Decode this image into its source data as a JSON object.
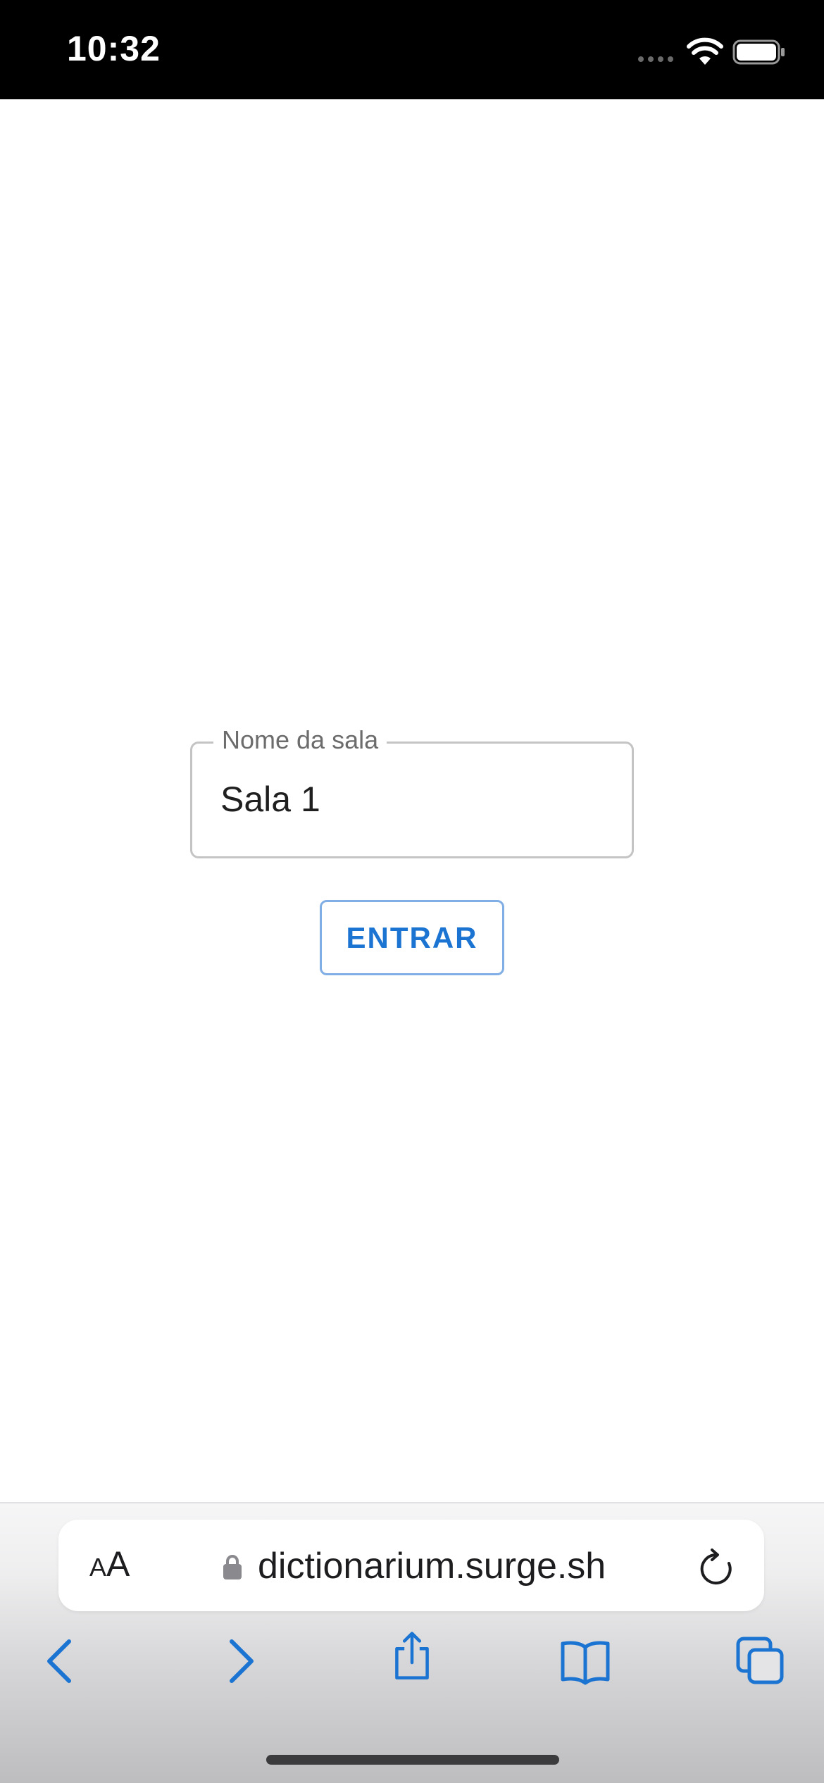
{
  "status_bar": {
    "time": "10:32",
    "wifi_icon": "wifi-icon",
    "battery_icon": "battery-icon"
  },
  "form": {
    "room_label": "Nome da sala",
    "room_value": "Sala 1",
    "enter_label": "ENTRAR"
  },
  "browser": {
    "text_size_small": "A",
    "text_size_large": "A",
    "url": "dictionarium.surge.sh",
    "icons": {
      "lock": "lock-icon",
      "reload": "reload-icon",
      "back": "back-icon",
      "forward": "forward-icon",
      "share": "share-icon",
      "bookmarks": "bookmarks-icon",
      "tabs": "tabs-icon"
    }
  },
  "colors": {
    "accent": "#1b74d2",
    "button_border": "#80aee5",
    "field_border": "#c4c4c4"
  }
}
